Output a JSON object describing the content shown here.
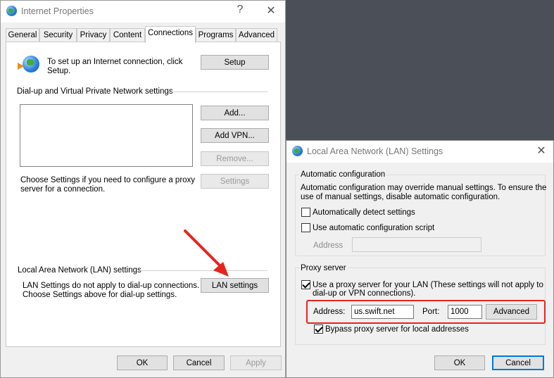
{
  "main_window": {
    "title": "Internet Properties",
    "help_button": "?",
    "close_button": "✕",
    "tabs": [
      "General",
      "Security",
      "Privacy",
      "Content",
      "Connections",
      "Programs",
      "Advanced"
    ],
    "active_tab": "Connections",
    "setup_text_line1": "To set up an Internet connection, click",
    "setup_text_line2": "Setup.",
    "setup_button": "Setup",
    "dialup_section_title": "Dial-up and Virtual Private Network settings",
    "add_button": "Add...",
    "add_vpn_button": "Add VPN...",
    "remove_button": "Remove...",
    "settings_button": "Settings",
    "proxy_hint_line1": "Choose Settings if you need to configure a proxy",
    "proxy_hint_line2": "server for a connection.",
    "lan_section_title": "Local Area Network (LAN) settings",
    "lan_text_line1": "LAN Settings do not apply to dial-up connections.",
    "lan_text_line2": "Choose Settings above for dial-up settings.",
    "lan_settings_button": "LAN settings",
    "ok_button": "OK",
    "cancel_button": "Cancel",
    "apply_button": "Apply"
  },
  "lan_dialog": {
    "title": "Local Area Network (LAN) Settings",
    "close_button": "✕",
    "auto_config_title": "Automatic configuration",
    "auto_config_desc_line1": "Automatic configuration may override manual settings.  To ensure the",
    "auto_config_desc_line2": "use of manual settings, disable automatic configuration.",
    "auto_detect_label": "Automatically detect settings",
    "auto_detect_checked": false,
    "auto_script_label": "Use automatic configuration script",
    "auto_script_checked": false,
    "script_address_label": "Address",
    "script_address_value": "",
    "proxy_title": "Proxy server",
    "use_proxy_label_line1": "Use a proxy server for your LAN (These settings will not apply to",
    "use_proxy_label_line2": "dial-up or VPN connections).",
    "use_proxy_checked": true,
    "proxy_address_label": "Address:",
    "proxy_address_value": "us.swift.net",
    "proxy_port_label": "Port:",
    "proxy_port_value": "1000",
    "advanced_button": "Advanced",
    "bypass_label": "Bypass proxy server for local addresses",
    "bypass_checked": true,
    "ok_button": "OK",
    "cancel_button": "Cancel"
  },
  "colors": {
    "annotation_red": "#e8231d",
    "desktop_background": "#4b4f57",
    "focus_blue": "#0078d7"
  }
}
